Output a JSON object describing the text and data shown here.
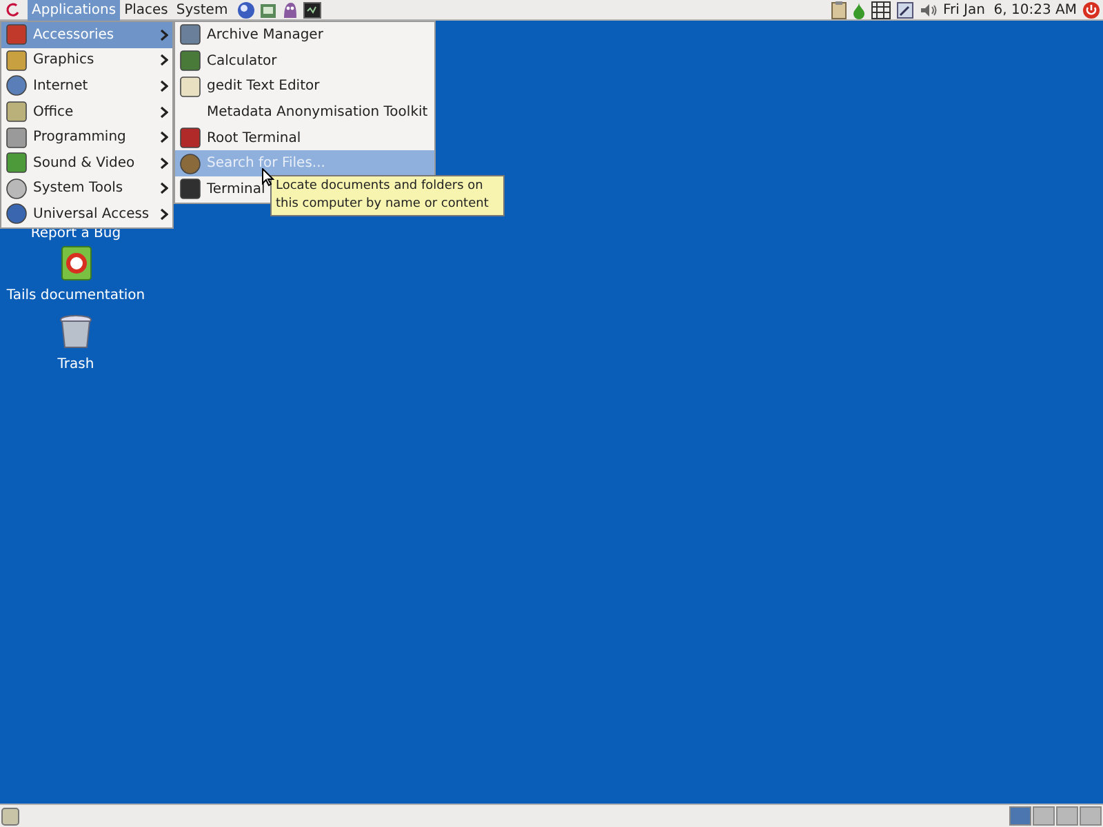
{
  "top_panel": {
    "menus": [
      {
        "label": "Applications",
        "selected": true
      },
      {
        "label": "Places",
        "selected": false
      },
      {
        "label": "System",
        "selected": false
      }
    ],
    "clock": "Fri Jan  6, 10:23 AM"
  },
  "applications_menu": {
    "items": [
      {
        "label": "Accessories",
        "selected": true
      },
      {
        "label": "Graphics",
        "selected": false
      },
      {
        "label": "Internet",
        "selected": false
      },
      {
        "label": "Office",
        "selected": false
      },
      {
        "label": "Programming",
        "selected": false
      },
      {
        "label": "Sound & Video",
        "selected": false
      },
      {
        "label": "System Tools",
        "selected": false
      },
      {
        "label": "Universal Access",
        "selected": false
      }
    ]
  },
  "accessories_menu": {
    "items": [
      {
        "label": "Archive Manager",
        "selected": false
      },
      {
        "label": "Calculator",
        "selected": false
      },
      {
        "label": "gedit Text Editor",
        "selected": false
      },
      {
        "label": "Metadata Anonymisation Toolkit",
        "selected": false
      },
      {
        "label": "Root Terminal",
        "selected": false
      },
      {
        "label": "Search for Files...",
        "selected": true
      },
      {
        "label": "Terminal",
        "selected": false
      }
    ]
  },
  "tooltip": "Locate documents and folders on this computer by name or content",
  "desktop_icons": [
    {
      "label": "Report a Bug"
    },
    {
      "label": "Tails documentation"
    },
    {
      "label": "Trash"
    }
  ],
  "workspaces": [
    {
      "selected": true
    },
    {
      "selected": false
    },
    {
      "selected": false
    },
    {
      "selected": false
    }
  ]
}
